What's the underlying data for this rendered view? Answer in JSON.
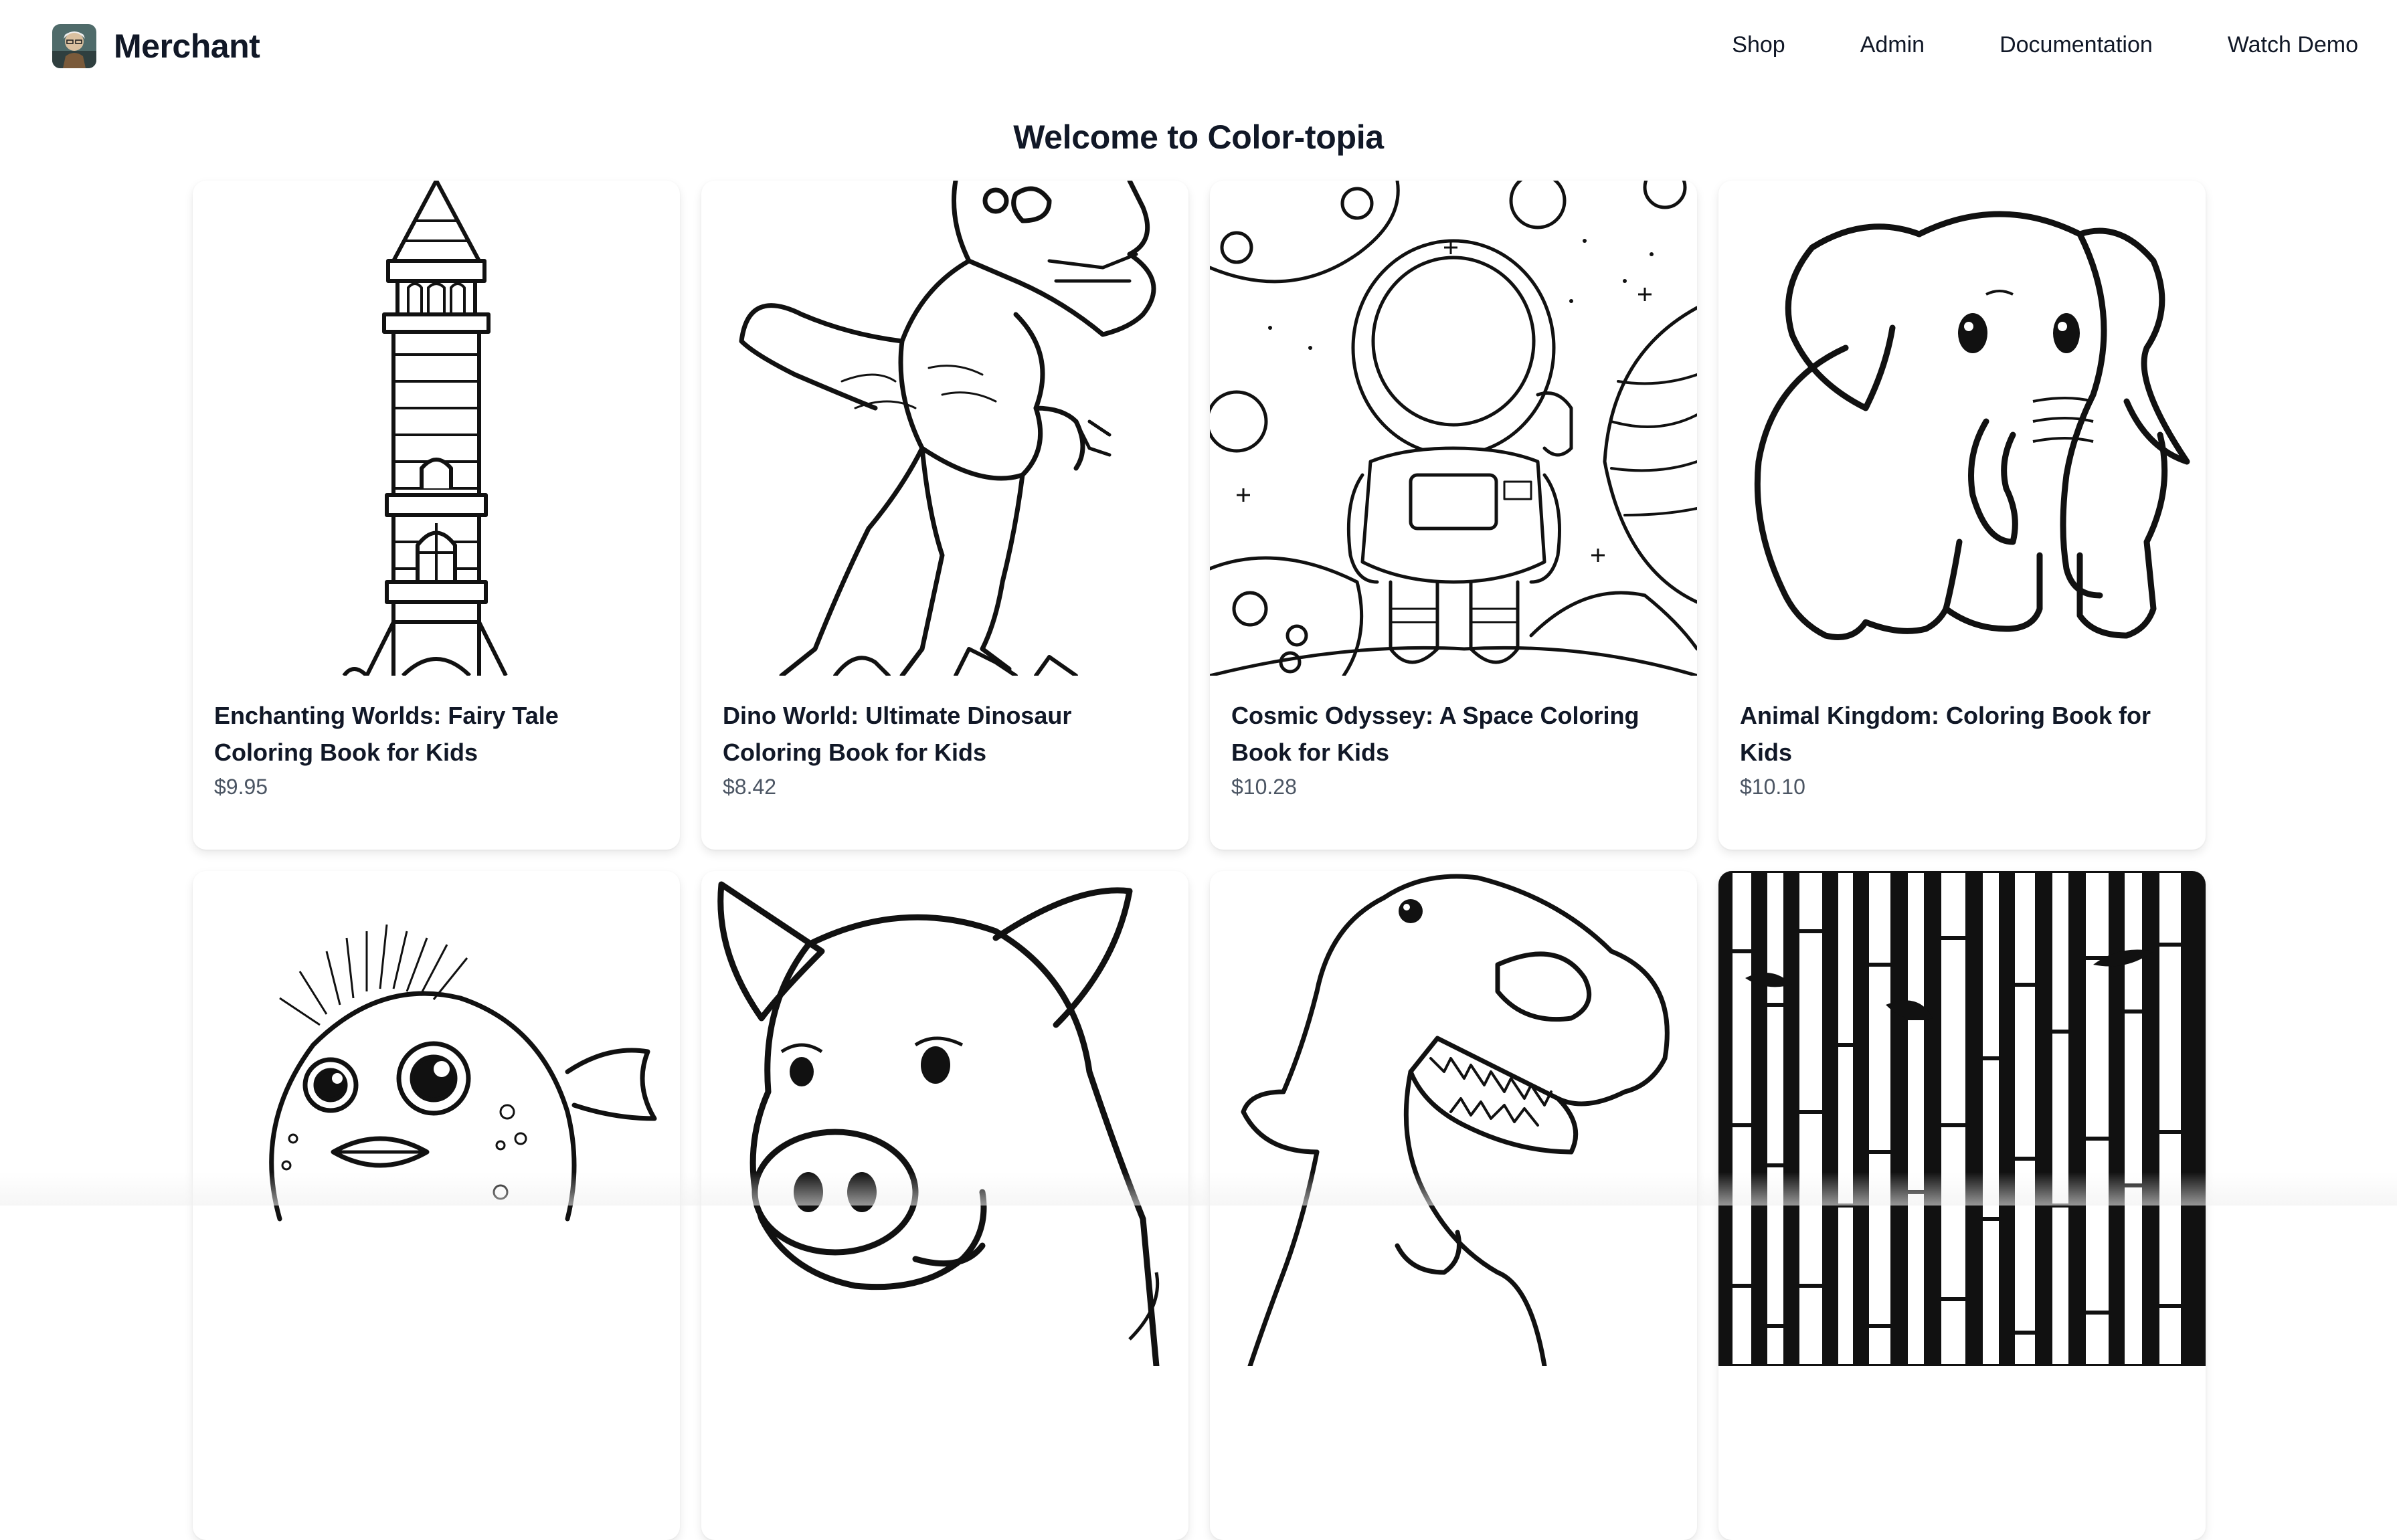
{
  "nav": {
    "brand": "Merchant",
    "logo_icon": "avatar-portrait-icon",
    "links": [
      "Shop",
      "Admin",
      "Documentation",
      "Watch Demo"
    ]
  },
  "hero": {
    "title": "Welcome to Color-topia"
  },
  "products": [
    {
      "title": "Enchanting Worlds: Fairy Tale Coloring Book for Kids",
      "price": "$9.95",
      "image_icon": "tower-illustration"
    },
    {
      "title": "Dino World: Ultimate Dinosaur Coloring Book for Kids",
      "price": "$8.42",
      "image_icon": "trex-illustration"
    },
    {
      "title": "Cosmic Odyssey: A Space Coloring Book for Kids",
      "price": "$10.28",
      "image_icon": "astronaut-illustration"
    },
    {
      "title": "Animal Kingdom: Coloring Book for Kids",
      "price": "$10.10",
      "image_icon": "elephant-illustration"
    },
    {
      "title": "",
      "price": "",
      "image_icon": "pufferfish-illustration"
    },
    {
      "title": "",
      "price": "",
      "image_icon": "pig-illustration"
    },
    {
      "title": "",
      "price": "",
      "image_icon": "trex-head-illustration"
    },
    {
      "title": "",
      "price": "",
      "image_icon": "bamboo-illustration"
    }
  ]
}
